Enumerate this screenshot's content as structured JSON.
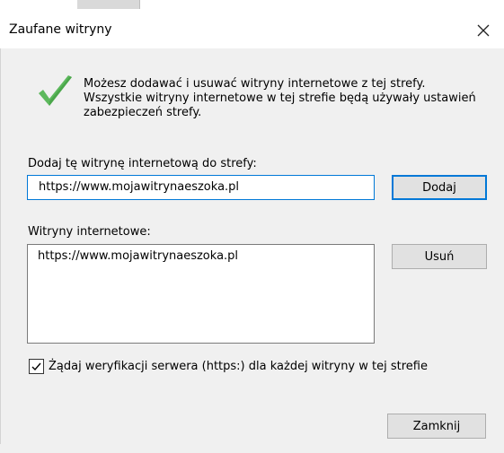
{
  "dialog": {
    "title": "Zaufane witryny",
    "info_text": "Możesz dodawać i usuwać witryny internetowe z tej strefy. Wszystkie witryny internetowe w tej strefie będą używały ustawień zabezpieczeń strefy.",
    "add_label": "Dodaj tę witrynę internetową do strefy:",
    "add_value": "https://www.mojawitrynaeszoka.pl",
    "add_button": "Dodaj",
    "sites_label": "Witryny internetowe:",
    "sites": [
      "https://www.mojawitrynaeszoka.pl"
    ],
    "remove_button": "Usuń",
    "require_https_label": "Żądaj weryfikacji serwera (https:) dla każdej witryny w tej strefie",
    "require_https_checked": true,
    "close_button": "Zamknij"
  },
  "icons": {
    "checkmark": "checkmark-icon",
    "close": "close-icon"
  },
  "colors": {
    "accent": "#0078d7",
    "check_green": "#5cb85c",
    "client_bg": "#f0f0f0"
  }
}
